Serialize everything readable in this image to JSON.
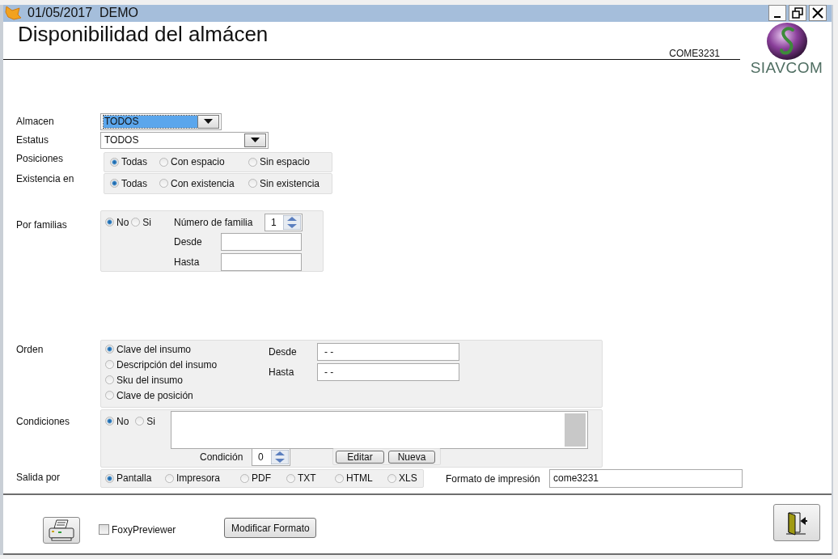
{
  "window": {
    "title": "01/05/2017  DEMO"
  },
  "header": {
    "title": "Disponibilidad del almácen",
    "code": "COME3231",
    "logo_text": "SIAVCOM"
  },
  "almacen": {
    "label": "Almacen",
    "value": "TODOS",
    "focused": true
  },
  "estatus": {
    "label": "Estatus",
    "value": "TODOS",
    "focused": false
  },
  "posiciones": {
    "label": "Posiciones",
    "options": [
      {
        "label": "Todas",
        "selected": true
      },
      {
        "label": "Con espacio",
        "selected": false
      },
      {
        "label": "Sin espacio",
        "selected": false
      }
    ]
  },
  "existencia": {
    "label": "Existencia en",
    "options": [
      {
        "label": "Todas",
        "selected": true
      },
      {
        "label": "Con existencia",
        "selected": false
      },
      {
        "label": "Sin existencia",
        "selected": false
      }
    ]
  },
  "familias": {
    "label": "Por familias",
    "options": [
      {
        "label": "No",
        "selected": true
      },
      {
        "label": "Si",
        "selected": false
      }
    ],
    "numero": {
      "label": "Número de familia",
      "value": "1"
    },
    "desde": {
      "label": "Desde"
    },
    "hasta": {
      "label": "Hasta"
    }
  },
  "orden": {
    "label": "Orden",
    "options": [
      {
        "label": "Clave del insumo",
        "selected": true
      },
      {
        "label": "Descripción del insumo",
        "selected": false
      },
      {
        "label": "Sku del insumo",
        "selected": false
      },
      {
        "label": "Clave de posición",
        "selected": false
      }
    ],
    "desde": {
      "label": "Desde",
      "value": "- -"
    },
    "hasta": {
      "label": "Hasta",
      "value": "- -"
    }
  },
  "condiciones": {
    "label": "Condiciones",
    "options": [
      {
        "label": "No",
        "selected": true
      },
      {
        "label": "Si",
        "selected": false
      }
    ],
    "condicion": {
      "label": "Condición",
      "value": "0"
    },
    "buttons": [
      "Editar",
      "Nueva"
    ]
  },
  "salida": {
    "label": "Salida por",
    "options": [
      {
        "label": "Pantalla",
        "selected": true
      },
      {
        "label": "Impresora",
        "selected": false
      },
      {
        "label": "PDF",
        "selected": false
      },
      {
        "label": "TXT",
        "selected": false
      },
      {
        "label": "HTML",
        "selected": false
      },
      {
        "label": "XLS",
        "selected": false
      }
    ],
    "formato": {
      "label": "Formato de impresión",
      "value": "come3231"
    }
  },
  "footer": {
    "preview": {
      "label": "FoxyPreviewer",
      "checked": false
    },
    "button": "Modificar Formato"
  }
}
